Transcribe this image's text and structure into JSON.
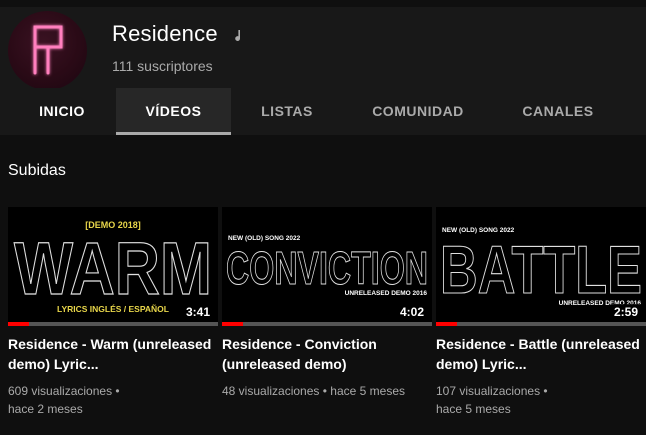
{
  "channel": {
    "name": "Residence",
    "subscribers": "111 suscriptores",
    "avatar_letter": "R",
    "verified_icon": "music-note-icon"
  },
  "tabs": [
    {
      "label": "INICIO",
      "active": false
    },
    {
      "label": "VÍDEOS",
      "active": true
    },
    {
      "label": "LISTAS",
      "active": false
    },
    {
      "label": "COMUNIDAD",
      "active": false
    },
    {
      "label": "CANALES",
      "active": false
    }
  ],
  "section": {
    "title": "Subidas"
  },
  "videos": [
    {
      "thumb_top": "[DEMO 2018]",
      "thumb_main": "WARM",
      "thumb_bottom": "LYRICS INGLÉS / ESPAÑOL",
      "duration": "3:41",
      "watched": 0.1,
      "title": "Residence - Warm (unreleased demo) Lyric...",
      "views": "609 visualizaciones •",
      "age": "hace 2 meses"
    },
    {
      "thumb_top": "NEW (OLD) SONG 2022",
      "thumb_main": "CONVICTION",
      "thumb_bottom": "UNRELEASED DEMO 2016",
      "duration": "4:02",
      "watched": 0.1,
      "title": "Residence - Conviction (unreleased demo)",
      "views": "48 visualizaciones •",
      "age": "hace 5 meses"
    },
    {
      "thumb_top": "NEW (OLD) SONG 2022",
      "thumb_main": "BATTLE",
      "thumb_bottom": "UNRELEASED DEMO 2016",
      "duration": "2:59",
      "watched": 0.1,
      "title": "Residence - Battle (unreleased demo) Lyric...",
      "views": "107 visualizaciones •",
      "age": "hace 5 meses"
    }
  ],
  "colors": {
    "accent_red": "#ff0000",
    "thumb_yellow": "#e8d64a",
    "avatar_pink": "#ff6fb0"
  }
}
